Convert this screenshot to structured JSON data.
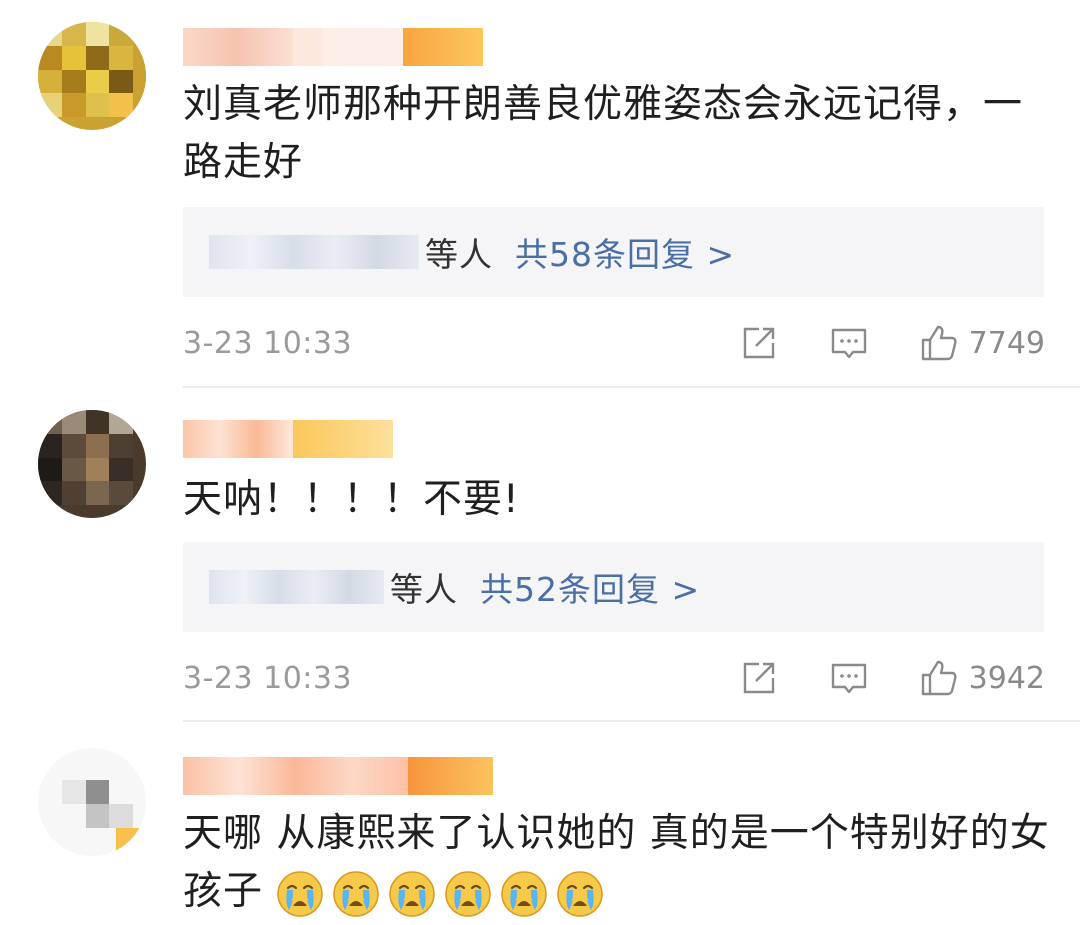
{
  "comments": [
    {
      "text": "刘真老师那种开朗善良优雅姿态会永远记得，一路走好",
      "reply_suffix": "等人",
      "reply_link": "共58条回复 >",
      "time": "3-23 10:33",
      "likes": "7749"
    },
    {
      "text": "天呐！！！！不要!",
      "reply_suffix": "等人",
      "reply_link": "共52条回复 >",
      "time": "3-23 10:33",
      "likes": "3942"
    },
    {
      "text": "天哪 从康熙来了认识她的 真的是一个特别好的女孩子",
      "emoji_icons": [
        "crying-face-icon",
        "crying-face-icon",
        "crying-face-icon",
        "crying-face-icon",
        "crying-face-icon",
        "crying-face-icon"
      ]
    }
  ],
  "colors": {
    "link": "#4a6fa5",
    "reply_bg": "#f5f5f7",
    "meta": "#9a9a9a"
  }
}
